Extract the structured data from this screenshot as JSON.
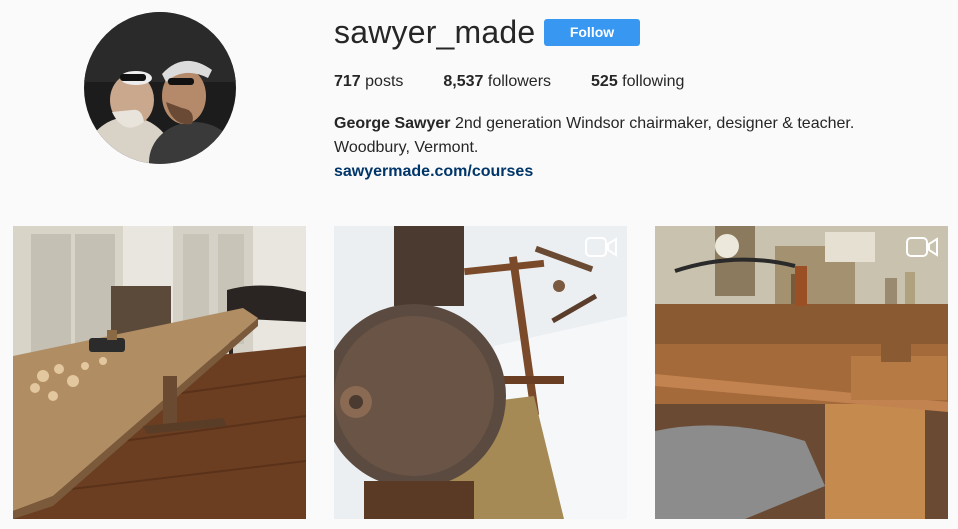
{
  "profile": {
    "username": "sawyer_made",
    "follow_label": "Follow",
    "stats": {
      "posts_count": "717",
      "posts_label": " posts",
      "followers_count": "8,537",
      "followers_label": " followers",
      "following_count": "525",
      "following_label": " following"
    },
    "bio": {
      "full_name": "George Sawyer",
      "line1": " 2nd generation Windsor chairmaker, designer & teacher.",
      "line2": "Woodbury, Vermont.",
      "link": "sawyermade.com/courses"
    },
    "avatar_icon": "profile-photo"
  },
  "posts": [
    {
      "kind": "photo",
      "subject": "workshop trestle table with wood shavings"
    },
    {
      "kind": "video",
      "subject": "rusty saw blade in snow",
      "badge_icon": "video-camera-icon"
    },
    {
      "kind": "video",
      "subject": "workbench with tools",
      "badge_icon": "video-camera-icon"
    }
  ],
  "colors": {
    "background": "#fafafa",
    "follow_button": "#3897f0",
    "link": "#003569",
    "text": "#262626"
  }
}
